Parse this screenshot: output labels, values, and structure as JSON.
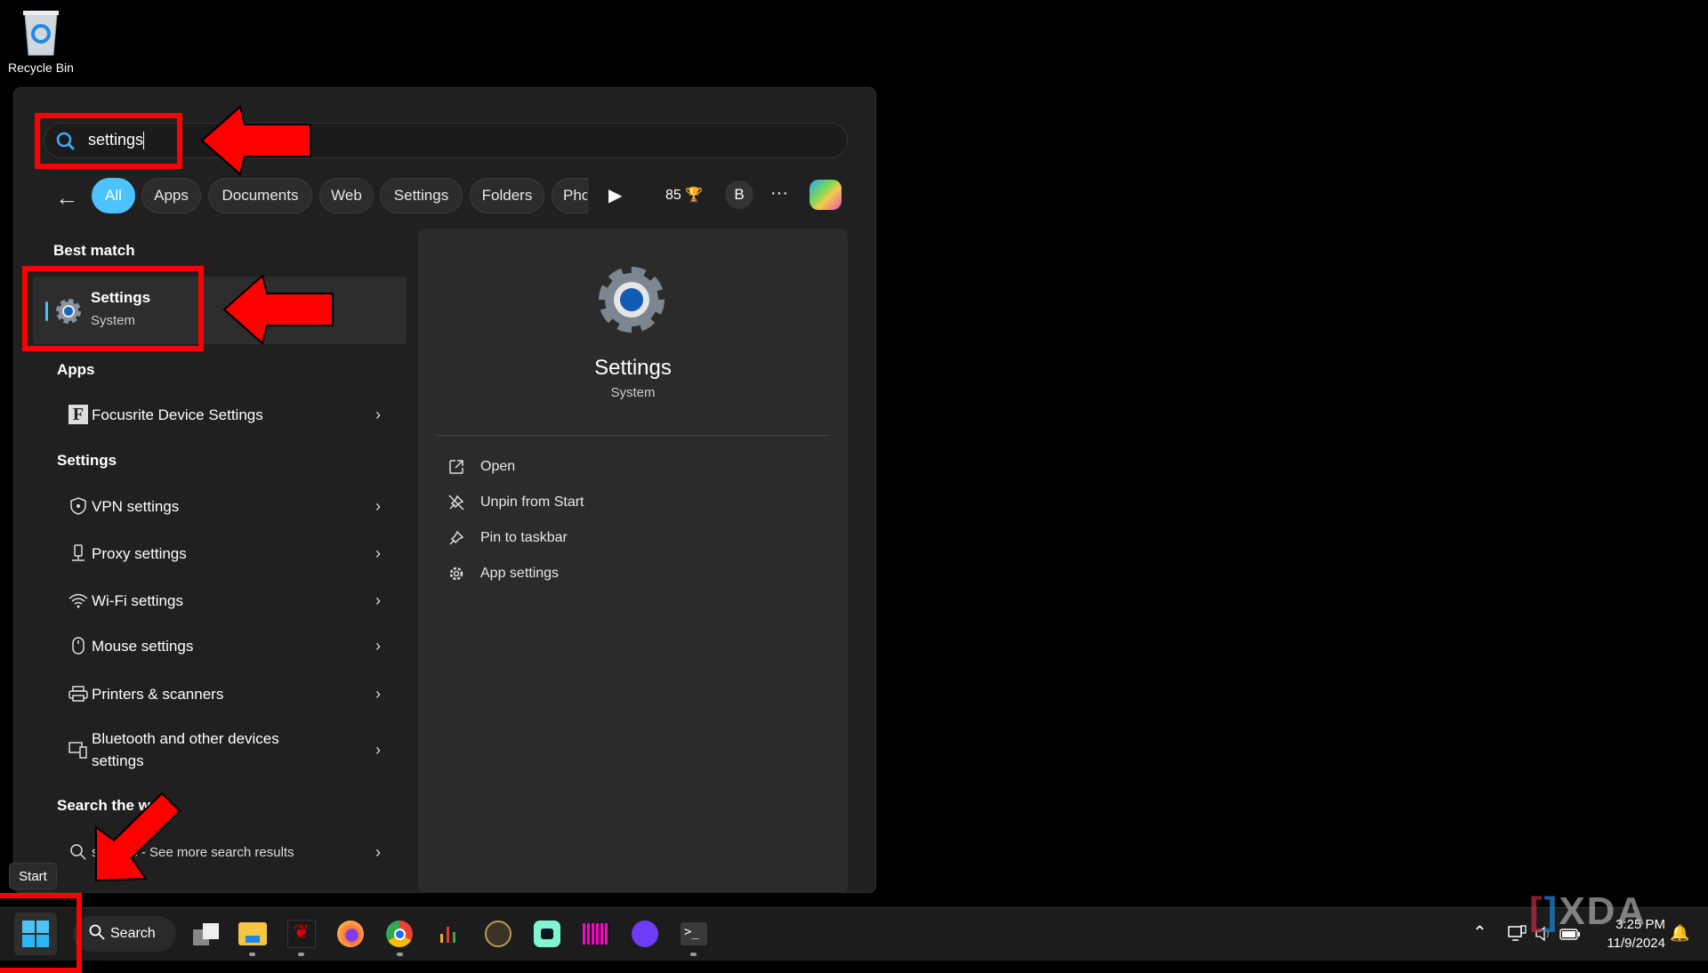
{
  "desktop": {
    "recycle_bin_label": "Recycle Bin"
  },
  "search": {
    "query": "settings",
    "icon": "search-icon"
  },
  "filters": {
    "back_icon": "arrow-left-icon",
    "chips": [
      "All",
      "Apps",
      "Documents",
      "Web",
      "Settings",
      "Folders",
      "Pho"
    ],
    "active": "All",
    "play_icon": "play-icon",
    "points": "85",
    "points_icon": "trophy-icon",
    "profile_initial": "B",
    "more_icon": "ellipsis-icon",
    "copilot_icon": "copilot-icon"
  },
  "results": {
    "best_match_header": "Best match",
    "best_match": {
      "title": "Settings",
      "subtitle": "System",
      "icon": "settings-gear-icon"
    },
    "apps_header": "Apps",
    "apps": [
      {
        "label": "Focusrite Device Settings",
        "icon": "focusrite-icon"
      }
    ],
    "settings_header": "Settings",
    "settings": [
      {
        "label": "VPN settings",
        "icon": "shield-icon"
      },
      {
        "label": "Proxy settings",
        "icon": "proxy-icon"
      },
      {
        "label": "Wi-Fi settings",
        "icon": "wifi-icon"
      },
      {
        "label": "Mouse settings",
        "icon": "mouse-icon"
      },
      {
        "label": "Printers & scanners",
        "icon": "printer-icon"
      },
      {
        "label": "Bluetooth and other devices settings",
        "icon": "bluetooth-devices-icon"
      }
    ],
    "web_header": "Search the web",
    "web": {
      "label": "settings - See more search results",
      "icon": "search-icon"
    }
  },
  "preview": {
    "title": "Settings",
    "subtitle": "System",
    "actions": [
      {
        "label": "Open",
        "icon": "open-external-icon"
      },
      {
        "label": "Unpin from Start",
        "icon": "unpin-icon"
      },
      {
        "label": "Pin to taskbar",
        "icon": "pin-icon"
      },
      {
        "label": "App settings",
        "icon": "gear-icon"
      }
    ]
  },
  "tooltip": "Start",
  "taskbar": {
    "search_label": "Search",
    "apps": [
      "task-view",
      "file-explorer",
      "msi-center",
      "firefox",
      "chrome",
      "audio-meter",
      "app-gold",
      "streamlabs",
      "tuul",
      "proton-pass",
      "terminal"
    ]
  },
  "tray": {
    "time": "3:25 PM",
    "date": "11/9/2024"
  },
  "watermark": "XDA",
  "colors": {
    "accent": "#4cc2ff",
    "annotation": "#ff0000"
  }
}
